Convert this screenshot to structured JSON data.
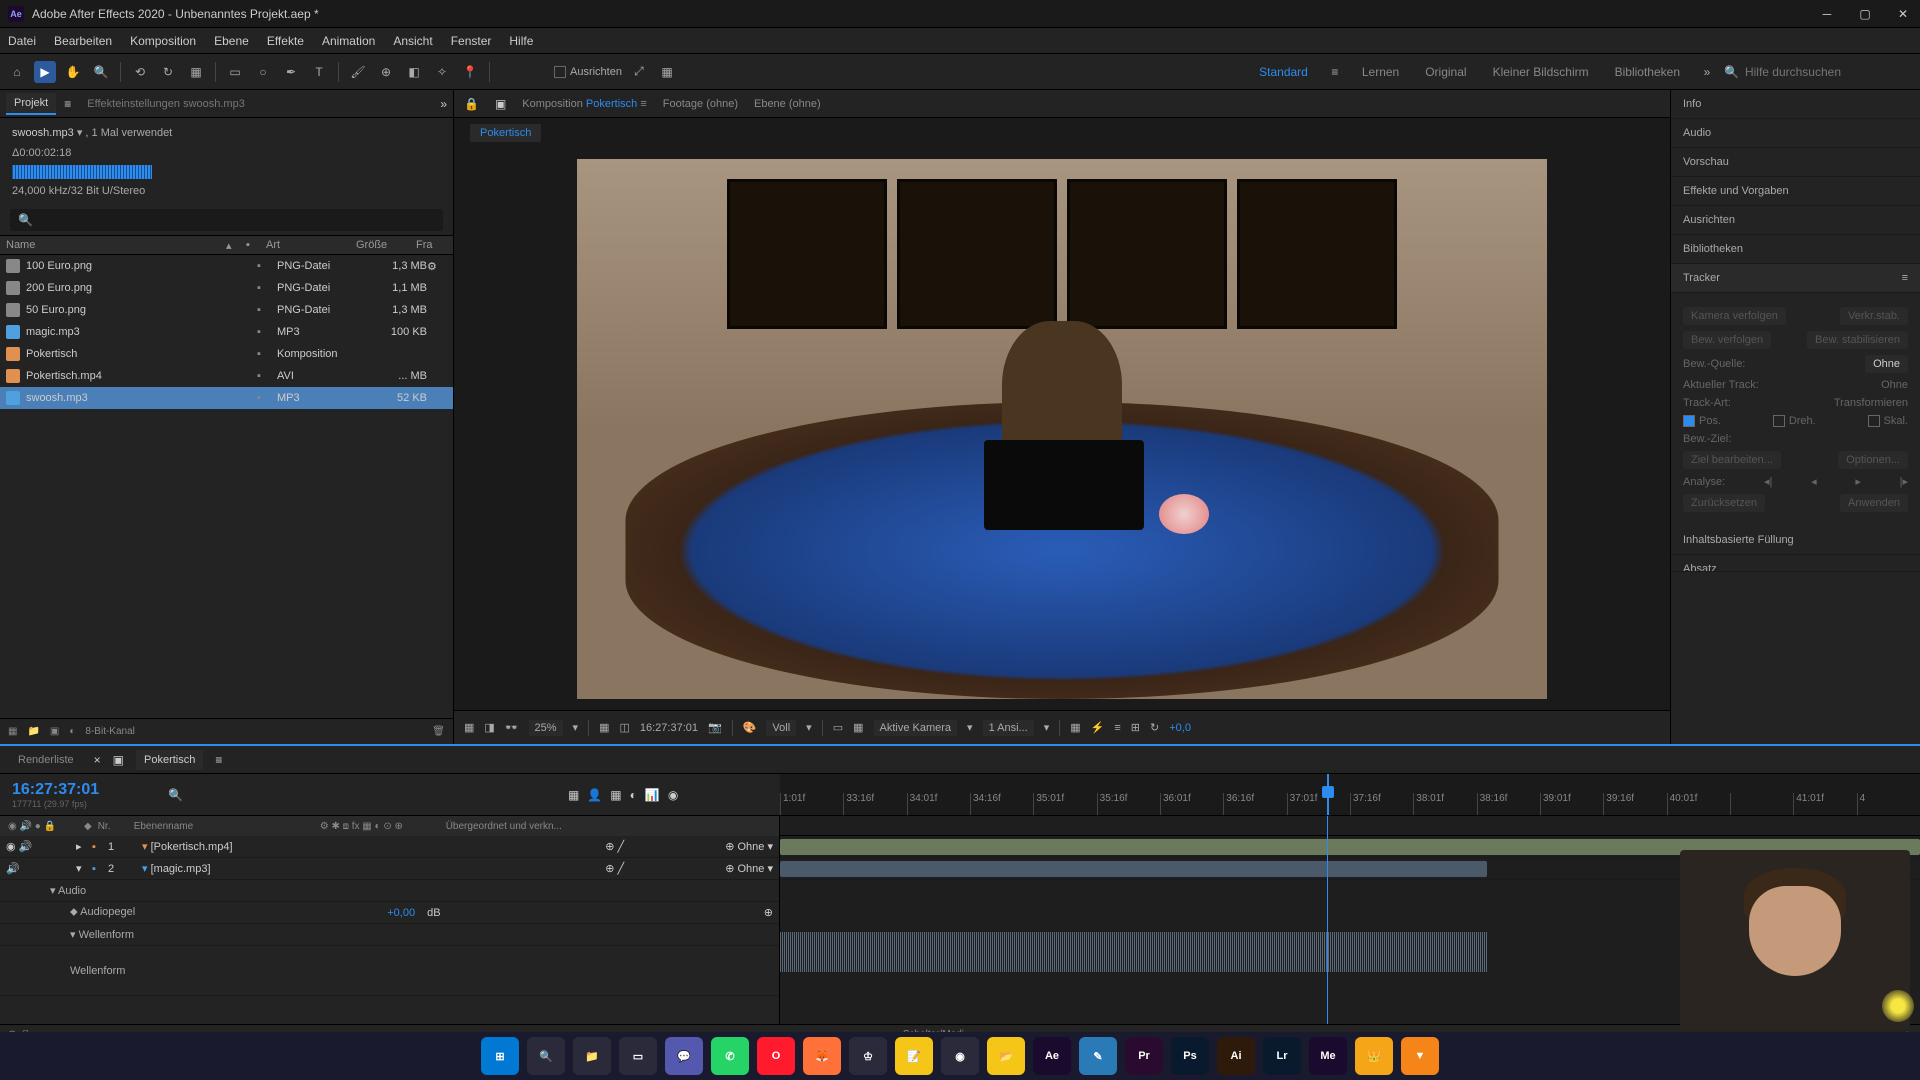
{
  "titlebar": {
    "title": "Adobe After Effects 2020 - Unbenanntes Projekt.aep *"
  },
  "menu": {
    "datei": "Datei",
    "bearbeiten": "Bearbeiten",
    "komposition": "Komposition",
    "ebene": "Ebene",
    "effekte": "Effekte",
    "animation": "Animation",
    "ansicht": "Ansicht",
    "fenster": "Fenster",
    "hilfe": "Hilfe"
  },
  "toolbar": {
    "snap": "Ausrichten",
    "search_ph": "Hilfe durchsuchen"
  },
  "workspaces": {
    "standard": "Standard",
    "lernen": "Lernen",
    "original": "Original",
    "kleiner": "Kleiner Bildschirm",
    "bibliotheken": "Bibliotheken"
  },
  "project": {
    "tab": "Projekt",
    "effect_tab": "Effekteinstellungen swoosh.mp3",
    "selected_name": "swoosh.mp3",
    "selected_usage": ", 1 Mal verwendet",
    "timecode": "Δ0:00:02:18",
    "audio_info": "24,000 kHz/32 Bit U/Stereo",
    "cols": {
      "name": "Name",
      "art": "Art",
      "groesse": "Größe",
      "fra": "Fra"
    },
    "items": [
      {
        "name": "100 Euro.png",
        "type": "PNG-Datei",
        "size": "1,3 MB"
      },
      {
        "name": "200 Euro.png",
        "type": "PNG-Datei",
        "size": "1,1 MB"
      },
      {
        "name": "50 Euro.png",
        "type": "PNG-Datei",
        "size": "1,3 MB"
      },
      {
        "name": "magic.mp3",
        "type": "MP3",
        "size": "100 KB"
      },
      {
        "name": "Pokertisch",
        "type": "Komposition",
        "size": ""
      },
      {
        "name": "Pokertisch.mp4",
        "type": "AVI",
        "size": "... MB"
      },
      {
        "name": "swoosh.mp3",
        "type": "MP3",
        "size": "52 KB"
      }
    ],
    "footer_bit": "8-Bit-Kanal"
  },
  "comp": {
    "tab_prefix": "Komposition",
    "tab_name": "Pokertisch",
    "footage": "Footage",
    "footage_state": "(ohne)",
    "ebene": "Ebene",
    "ebene_state": "(ohne)",
    "crumb": "Pokertisch",
    "zoom": "25%",
    "timecode": "16:27:37:01",
    "res": "Voll",
    "camera": "Aktive Kamera",
    "views": "1 Ansi...",
    "exposure": "+0,0"
  },
  "right": {
    "info": "Info",
    "audio": "Audio",
    "vorschau": "Vorschau",
    "effekte": "Effekte und Vorgaben",
    "ausrichten": "Ausrichten",
    "bibliotheken": "Bibliotheken",
    "tracker": "Tracker",
    "kamera_verfolgen": "Kamera verfolgen",
    "verkr_stab": "Verkr.stab.",
    "bew_verfolgen": "Bew. verfolgen",
    "bew_stab": "Bew. stabilisieren",
    "quelle_label": "Bew.-Quelle:",
    "quelle_val": "Ohne",
    "track_label": "Aktueller Track:",
    "track_val": "Ohne",
    "art_label": "Track-Art:",
    "art_val": "Transformieren",
    "pos": "Pos.",
    "dreh": "Dreh.",
    "skal": "Skal.",
    "ziel": "Bew.-Ziel:",
    "ziel_bearb": "Ziel bearbeiten...",
    "optionen": "Optionen...",
    "analyse": "Analyse:",
    "zuruecksetzen": "Zurücksetzen",
    "anwenden": "Anwenden",
    "content_fill": "Inhaltsbasierte Füllung",
    "absatz": "Absatz"
  },
  "timeline": {
    "render_tab": "Renderliste",
    "comp_tab": "Pokertisch",
    "timecode": "16:27:37:01",
    "sub": "177711 (29.97 fps)",
    "cols": {
      "nr": "Nr.",
      "name": "Ebenenname",
      "parent": "Übergeordnet und verkn..."
    },
    "layers": [
      {
        "nr": "1",
        "name": "[Pokertisch.mp4]",
        "mode": "Ohne"
      },
      {
        "nr": "2",
        "name": "[magic.mp3]",
        "mode": "Ohne"
      }
    ],
    "audio": "Audio",
    "audiopegel": "Audiopegel",
    "pegel_val": "+0,00",
    "pegel_unit": "dB",
    "wellenform": "Wellenform",
    "wellenform2": "Wellenform",
    "switches": "Schalter/Modi",
    "ticks": [
      "1:01f",
      "33:16f",
      "34:01f",
      "34:16f",
      "35:01f",
      "35:16f",
      "36:01f",
      "36:16f",
      "37:01f",
      "37:16f",
      "38:01f",
      "38:16f",
      "39:01f",
      "39:16f",
      "40:01f",
      "",
      "41:01f",
      "4"
    ]
  },
  "taskbar": {
    "icons": [
      {
        "name": "start",
        "bg": "#0078d4",
        "txt": "⊞"
      },
      {
        "name": "search",
        "bg": "#2a2a3a",
        "txt": "🔍"
      },
      {
        "name": "explorer",
        "bg": "#2a2a3a",
        "txt": "📁"
      },
      {
        "name": "taskview",
        "bg": "#2a2a3a",
        "txt": "▭"
      },
      {
        "name": "teams",
        "bg": "#5558af",
        "txt": "💬"
      },
      {
        "name": "whatsapp",
        "bg": "#25d366",
        "txt": "✆"
      },
      {
        "name": "opera",
        "bg": "#ff1b2d",
        "txt": "O"
      },
      {
        "name": "firefox",
        "bg": "#ff7139",
        "txt": "🦊"
      },
      {
        "name": "chess",
        "bg": "#2a2a3a",
        "txt": "♔"
      },
      {
        "name": "notes",
        "bg": "#f5c518",
        "txt": "📝"
      },
      {
        "name": "obs",
        "bg": "#2a2a3a",
        "txt": "◉"
      },
      {
        "name": "files",
        "bg": "#f5c518",
        "txt": "📂"
      },
      {
        "name": "ae",
        "bg": "#1a0a2e",
        "txt": "Ae"
      },
      {
        "name": "editor",
        "bg": "#2a7ab8",
        "txt": "✎"
      },
      {
        "name": "pr",
        "bg": "#2a0a2e",
        "txt": "Pr"
      },
      {
        "name": "ps",
        "bg": "#0a1a2e",
        "txt": "Ps"
      },
      {
        "name": "ai",
        "bg": "#2e1a0a",
        "txt": "Ai"
      },
      {
        "name": "lr",
        "bg": "#0a1a2e",
        "txt": "Lr"
      },
      {
        "name": "me",
        "bg": "#1a0a2e",
        "txt": "Me"
      },
      {
        "name": "app1",
        "bg": "#f5a518",
        "txt": "👑"
      },
      {
        "name": "app2",
        "bg": "#f58518",
        "txt": "▼"
      }
    ]
  }
}
